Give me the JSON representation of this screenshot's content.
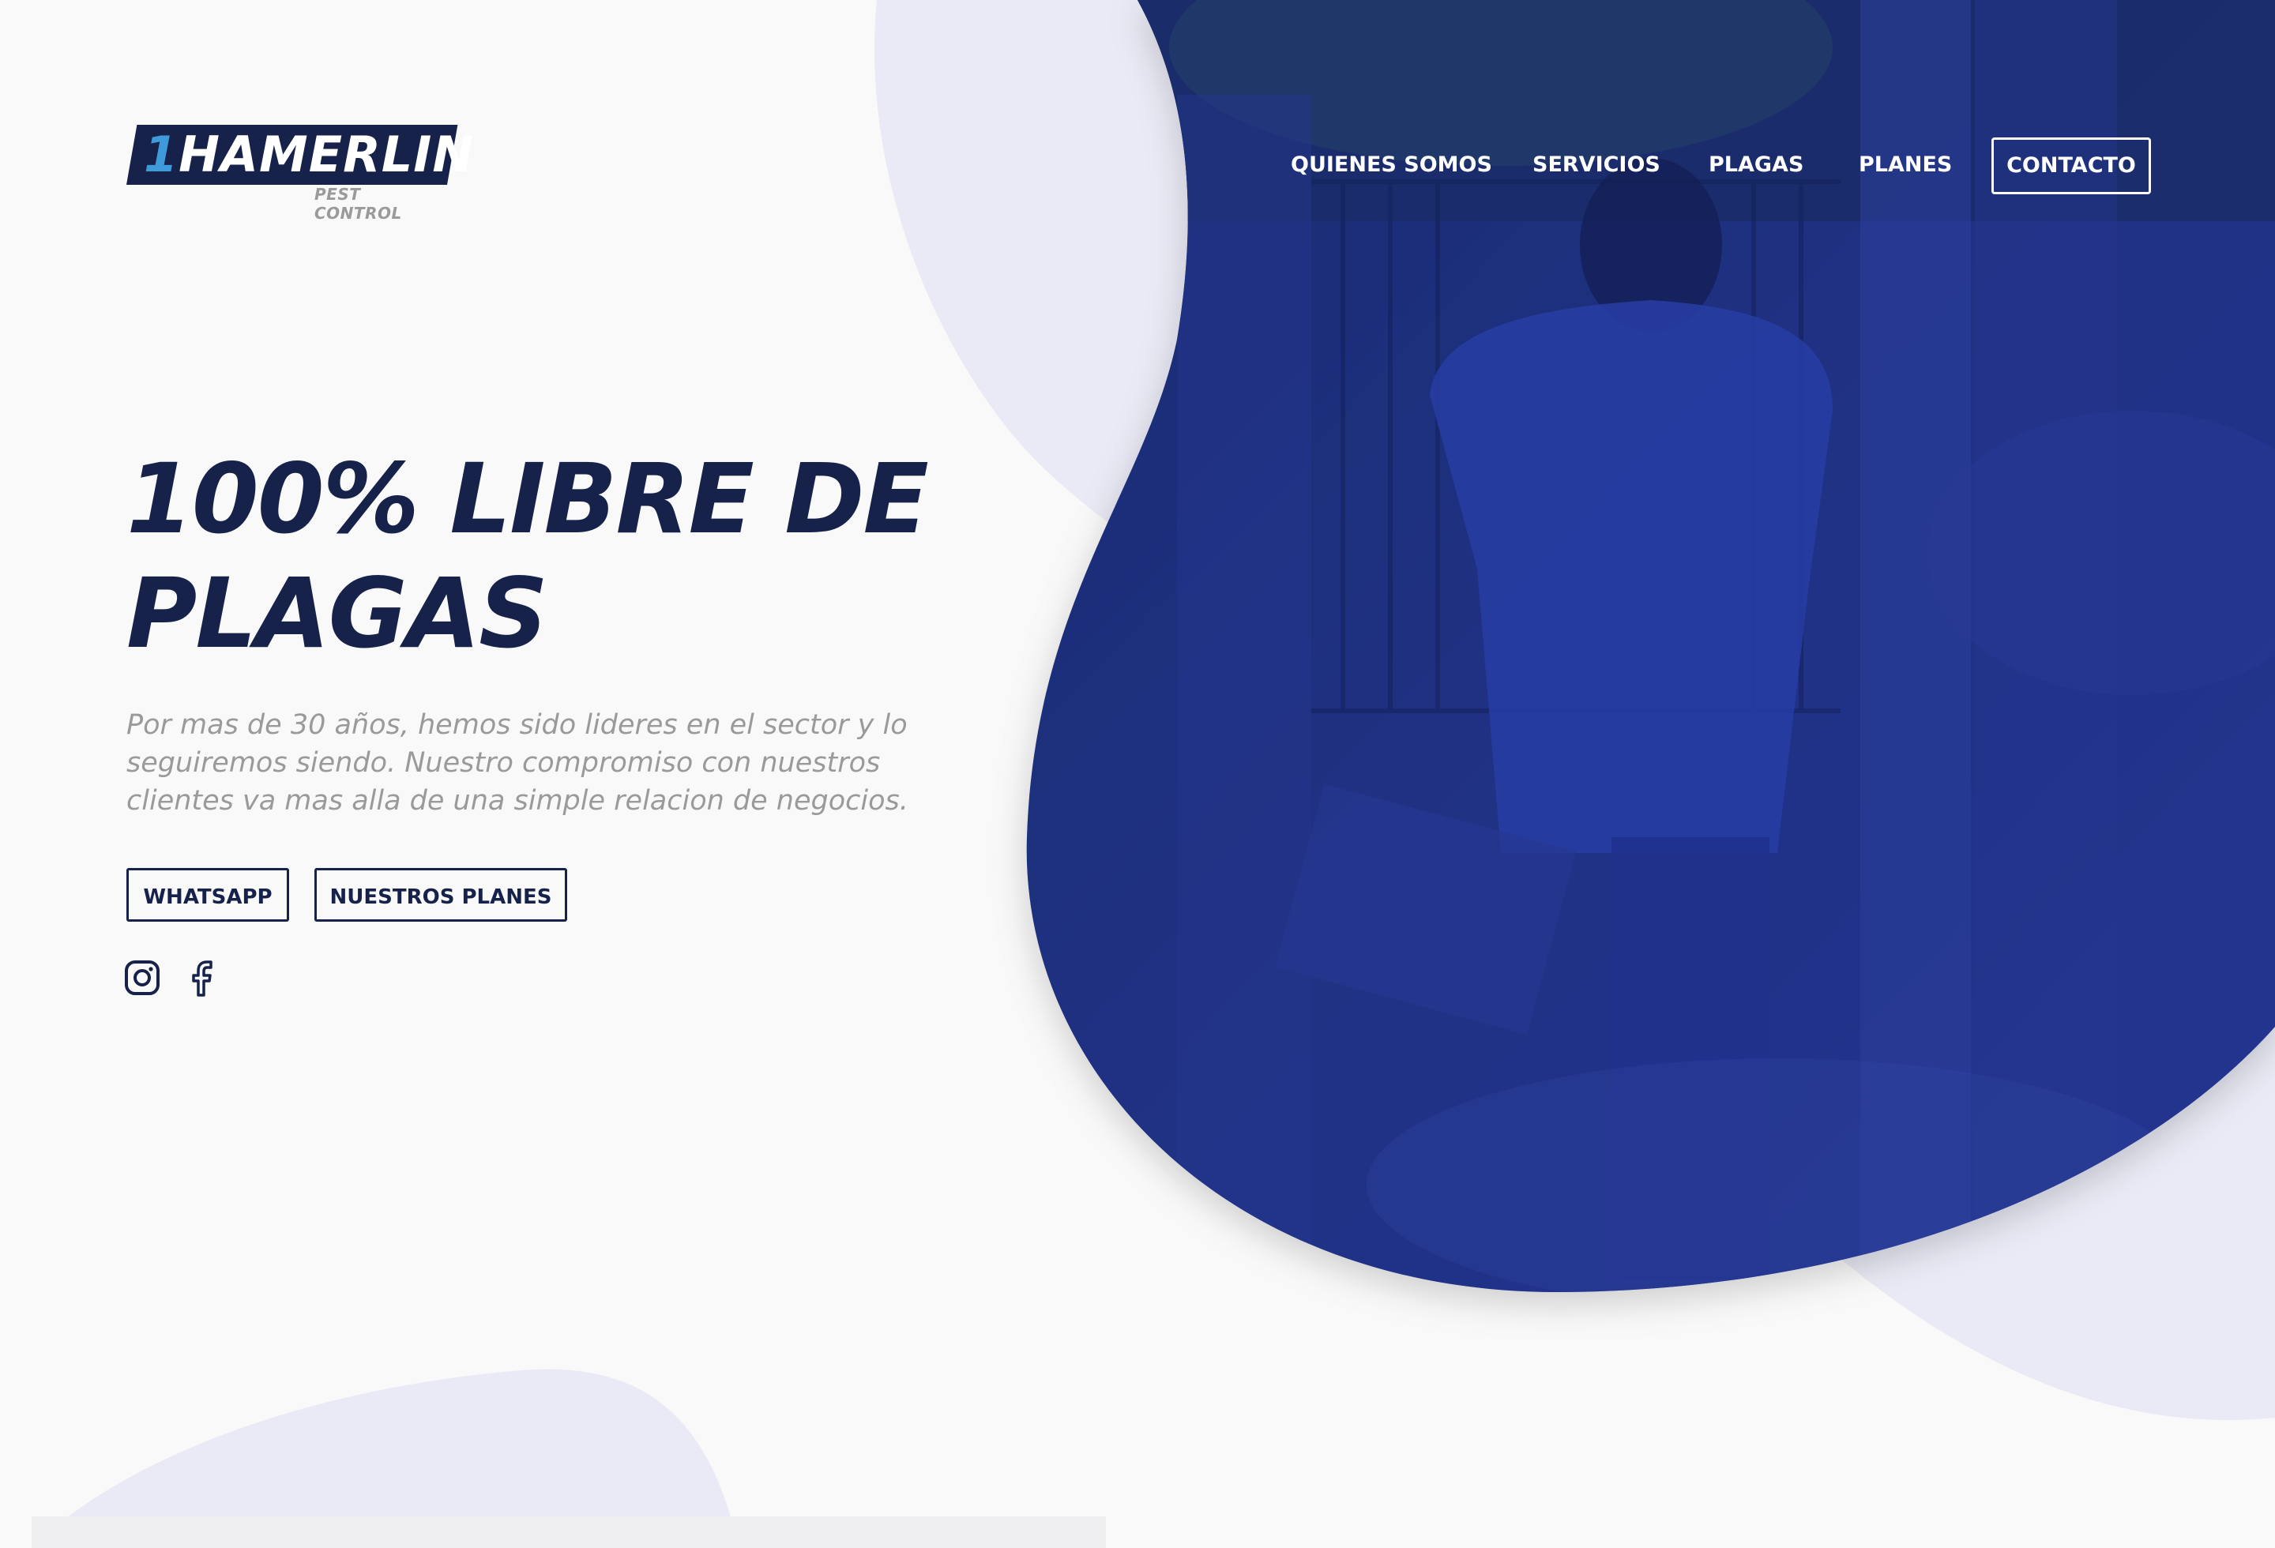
{
  "brand": {
    "logo_mark": "1",
    "logo_text": "HAMERLIN",
    "logo_sub": "PEST CONTROL"
  },
  "nav": {
    "items": [
      {
        "label": "QUIENES SOMOS"
      },
      {
        "label": "SERVICIOS"
      },
      {
        "label": "PLAGAS"
      },
      {
        "label": "PLANES"
      }
    ],
    "contact_label": "CONTACTO"
  },
  "hero": {
    "title": "100% LIBRE DE PLAGAS",
    "subtitle": "Por mas de 30 años, hemos sido lideres en el sector y lo seguiremos siendo. Nuestro compromiso con nuestros clientes va mas alla de una simple relacion de negocios.",
    "buttons": {
      "whatsapp_label": "WHATSAPP",
      "planes_label": "NUESTROS PLANES"
    }
  },
  "social": {
    "icons": [
      "instagram-icon",
      "facebook-icon"
    ]
  },
  "colors": {
    "navy": "#17224a",
    "hero_overlay": "#1c2f7e",
    "blob_light": "#eaeaf6",
    "background": "#f9f9f9",
    "muted_text": "#9a9a9a",
    "logo_accent": "#3e9ad8"
  }
}
